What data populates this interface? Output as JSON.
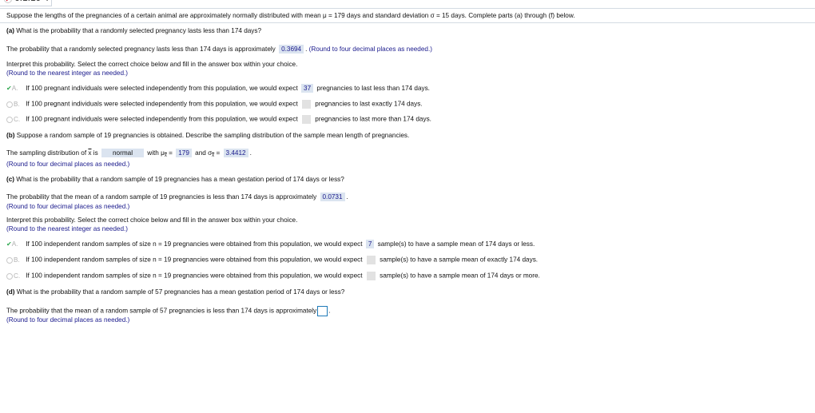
{
  "header": {
    "problem_id": "6.1.19-T",
    "status_icon": "incorrect-x-icon"
  },
  "intro": "Suppose the lengths of the pregnancies of a certain animal are approximately normally distributed with mean μ = 179 days and standard deviation σ = 15 days. Complete parts (a) through (f) below.",
  "part_a": {
    "label": "(a)",
    "question": "What is the probability that a randomly selected pregnancy lasts less than 174 days?",
    "answer_prefix": "The probability that a randomly selected pregnancy lasts less than 174 days is approximately",
    "answer_value": "0.3694",
    "answer_suffix": ".",
    "round_note": "(Round to four decimal places as needed.)",
    "interpret_prompt": "Interpret this probability. Select the correct choice below and fill in the answer box within your choice.",
    "interpret_round": "(Round to the nearest integer as needed.)",
    "choices": [
      {
        "letter": "A.",
        "selected": true,
        "prefix": "If 100 pregnant individuals were selected independently from this population, we would expect",
        "value": "37",
        "suffix": "pregnancies to last less than 174 days."
      },
      {
        "letter": "B.",
        "selected": false,
        "prefix": "If 100 pregnant individuals were selected independently from this population, we would expect",
        "value": "",
        "suffix": "pregnancies to last exactly 174 days."
      },
      {
        "letter": "C.",
        "selected": false,
        "prefix": "If 100 pregnant individuals were selected independently from this population, we would expect",
        "value": "",
        "suffix": "pregnancies to last more than 174 days."
      }
    ]
  },
  "part_b": {
    "label": "(b)",
    "question": "Suppose a random sample of 19 pregnancies is obtained. Describe the sampling distribution of the sample mean length of pregnancies.",
    "answer_prefix": "The sampling distribution of",
    "xbar": "x",
    "is": "is",
    "distribution": "normal",
    "with": "with μ",
    "mu_eq": "=",
    "mu_value": "179",
    "and": "and σ",
    "sigma_eq": "=",
    "sigma_value": "3.4412",
    "period": ".",
    "round_note": "(Round to four decimal places as needed.)"
  },
  "part_c": {
    "label": "(c)",
    "question": "What is the probability that a random sample of 19 pregnancies has a mean gestation period of 174 days or less?",
    "answer_prefix": "The probability that the mean of a random sample of 19 pregnancies is less than 174 days is approximately",
    "answer_value": "0.0731",
    "answer_suffix": ".",
    "round_note": "(Round to four decimal places as needed.)",
    "interpret_prompt": "Interpret this probability. Select the correct choice below and fill in the answer box within your choice.",
    "interpret_round": "(Round to the nearest integer as needed.)",
    "choices": [
      {
        "letter": "A.",
        "selected": true,
        "prefix": "If 100 independent random samples of size n = 19 pregnancies were obtained from this population, we would expect",
        "value": "7",
        "suffix": "sample(s) to have a sample mean of 174 days or less."
      },
      {
        "letter": "B.",
        "selected": false,
        "prefix": "If 100 independent random samples of size n = 19 pregnancies were obtained from this population, we would expect",
        "value": "",
        "suffix": "sample(s) to have a sample mean of exactly 174 days."
      },
      {
        "letter": "C.",
        "selected": false,
        "prefix": "If 100 independent random samples of size n = 19 pregnancies were obtained from this population, we would expect",
        "value": "",
        "suffix": "sample(s) to have a sample mean of 174 days or more."
      }
    ]
  },
  "part_d": {
    "label": "(d)",
    "question": "What is the probability that a random sample of 57 pregnancies has a mean gestation period of 174 days or less?",
    "answer_prefix": "The probability that the mean of a random sample of 57 pregnancies is less than 174 days is approximately",
    "answer_value": "",
    "answer_suffix": ".",
    "round_note": "(Round to four decimal places as needed.)"
  }
}
